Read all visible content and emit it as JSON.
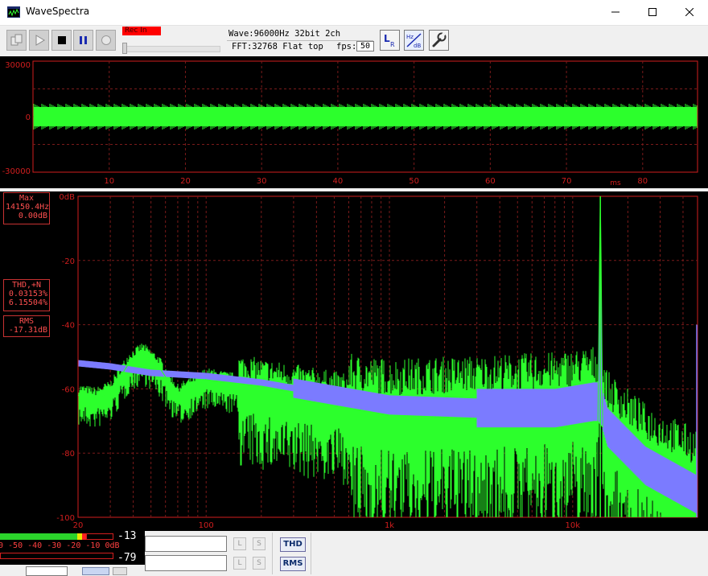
{
  "window": {
    "title": "WaveSpectra"
  },
  "toolbar": {
    "rec_label": "Rec In",
    "wave_info": "Wave:96000Hz 32bit 2ch",
    "fft_info": "FFT:32768 Flat top",
    "fps_label": "fps:",
    "fps_value": "50"
  },
  "wave_chart": {
    "y_ticks": [
      "30000",
      "0",
      "-30000"
    ],
    "x_ticks": [
      "10",
      "20",
      "30",
      "40",
      "50",
      "60",
      "70",
      "80"
    ],
    "x_unit": "ms"
  },
  "spectrum": {
    "max_label": "Max",
    "max_freq": "14150.4Hz",
    "max_db": "0.00dB",
    "thd_label": "THD,+N",
    "thd_value": "0.03153%",
    "thdn_value": "6.15504%",
    "rms_label": "RMS",
    "rms_value": "-17.31dB"
  },
  "meter": {
    "scale": "0 -50 -40 -30 -20 -10 0dB",
    "level_top": "-13",
    "level_bottom": "-79"
  },
  "bottom": {
    "l_label": "L",
    "s_label": "S",
    "thd_button": "THD",
    "rms_button": "RMS"
  },
  "chart_data": {
    "type": "line",
    "xlabel": "",
    "ylabel": "",
    "x_scale": "log",
    "xlim": [
      20,
      48000
    ],
    "ylim": [
      -100,
      0
    ],
    "x_tick_labels": [
      "20",
      "100",
      "1k",
      "10k"
    ],
    "y_tick_labels": [
      "0dB",
      "-20",
      "-40",
      "-60",
      "-80",
      "-100"
    ],
    "grid": true,
    "series": [
      {
        "name": "",
        "color": "#2cff2c",
        "x": [
          20,
          25,
          30,
          38,
          45,
          55,
          70,
          100,
          200,
          500,
          1000,
          3000,
          8000,
          13000,
          14150,
          15500,
          25000,
          48000
        ],
        "y": [
          -62,
          -63,
          -61,
          -52,
          -49,
          -53,
          -62,
          -57,
          -60,
          -64,
          -66,
          -65,
          -64,
          -62,
          0,
          -70,
          -80,
          -88
        ]
      },
      {
        "name": "",
        "color": "#7b7bff",
        "x": [
          20,
          30,
          50,
          100,
          200,
          500,
          1000,
          3000,
          8000,
          13000,
          14150,
          15500,
          25000,
          48000
        ],
        "y": [
          -52,
          -53,
          -55,
          -56,
          -58,
          -62,
          -65,
          -66,
          -66,
          -64,
          0,
          -72,
          -84,
          -93
        ]
      }
    ]
  },
  "colors": {
    "background": "#000000",
    "grid": "#7a1a1a",
    "axis_text": "#d21e1e",
    "left_channel": "#2cff2c",
    "right_channel": "#7b7bff"
  }
}
